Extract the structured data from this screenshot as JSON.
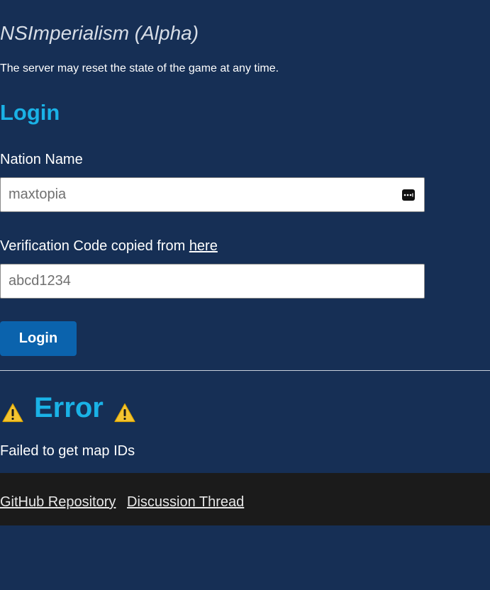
{
  "header": {
    "title": "NSImperialism (Alpha)",
    "notice": "The server may reset the state of the game at any time."
  },
  "login": {
    "heading": "Login",
    "nation_label": "Nation Name",
    "nation_placeholder": "maxtopia",
    "code_label_prefix": "Verification Code copied from ",
    "code_link_text": "here",
    "code_placeholder": "abcd1234",
    "submit_label": "Login"
  },
  "error": {
    "heading": "Error",
    "message": "Failed to get map IDs"
  },
  "footer": {
    "links": [
      {
        "label": "GitHub Repository"
      },
      {
        "label": "Discussion Thread"
      }
    ]
  },
  "icons": {
    "password_manager": "password-manager-icon",
    "warning": "warning-icon"
  },
  "colors": {
    "background": "#162f55",
    "accent": "#1ab2e6",
    "button": "#0b63ad",
    "footer": "#1b1b1b",
    "warning": "#f4c430"
  }
}
